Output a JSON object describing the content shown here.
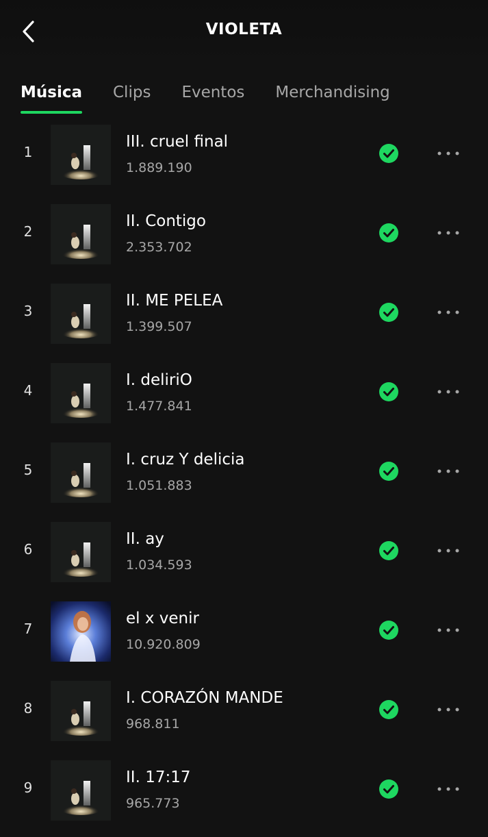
{
  "header": {
    "title": "VIOLETA",
    "back_icon": "chevron-left-icon"
  },
  "tabs": [
    {
      "label": "Música",
      "active": true
    },
    {
      "label": "Clips",
      "active": false
    },
    {
      "label": "Eventos",
      "active": false
    },
    {
      "label": "Merchandising",
      "active": false
    }
  ],
  "colors": {
    "accent": "#1ed760",
    "background": "#121212",
    "secondary_text": "#a7a7a7"
  },
  "tracks": [
    {
      "rank": "1",
      "title": "III. cruel final",
      "plays": "1.889.190",
      "cover": "dark-spotlight-cover",
      "saved": true
    },
    {
      "rank": "2",
      "title": "II. Contigo",
      "plays": "2.353.702",
      "cover": "dark-spotlight-cover",
      "saved": true
    },
    {
      "rank": "3",
      "title": "II. ME PELEA",
      "plays": "1.399.507",
      "cover": "dark-spotlight-cover",
      "saved": true
    },
    {
      "rank": "4",
      "title": "I. deliriO",
      "plays": "1.477.841",
      "cover": "dark-spotlight-cover",
      "saved": true
    },
    {
      "rank": "5",
      "title": "I. cruz Y delicia",
      "plays": "1.051.883",
      "cover": "dark-spotlight-cover",
      "saved": true
    },
    {
      "rank": "6",
      "title": "II. ay",
      "plays": "1.034.593",
      "cover": "dark-spotlight-cover",
      "saved": true
    },
    {
      "rank": "7",
      "title": "el x venir",
      "plays": "10.920.809",
      "cover": "blue-portrait-cover",
      "saved": true
    },
    {
      "rank": "8",
      "title": "I. CORAZÓN MANDE",
      "plays": "968.811",
      "cover": "dark-spotlight-cover",
      "saved": true
    },
    {
      "rank": "9",
      "title": "II. 17:17",
      "plays": "965.773",
      "cover": "dark-spotlight-cover",
      "saved": true
    }
  ],
  "row_icons": {
    "saved": "check-circle-icon",
    "more": "more-options-icon"
  }
}
